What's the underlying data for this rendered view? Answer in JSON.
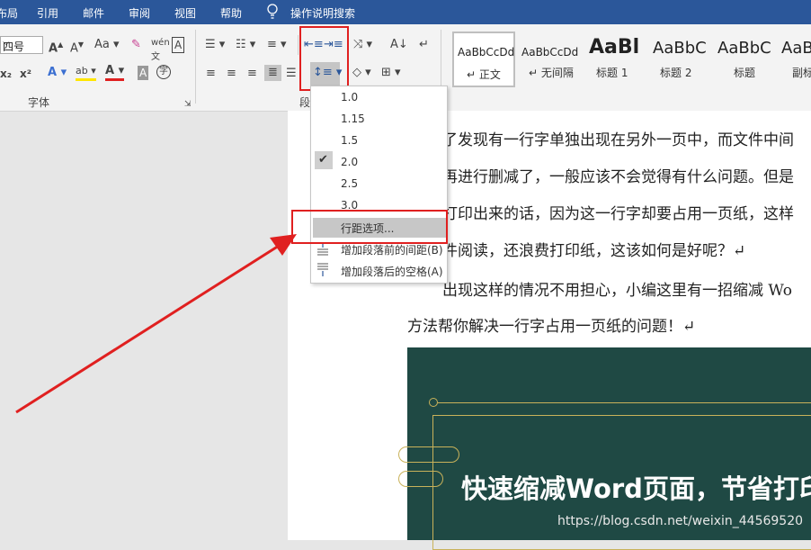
{
  "menubar": {
    "items": [
      "布局",
      "引用",
      "邮件",
      "审阅",
      "视图",
      "帮助"
    ],
    "search": "操作说明搜索"
  },
  "ribbon": {
    "font_size_value": "四号",
    "font_group_label": "字体",
    "para_group_label": "段"
  },
  "styles": [
    {
      "preview": "AaBbCcDd",
      "name": "↵ 正文"
    },
    {
      "preview": "AaBbCcDd",
      "name": "↵ 无间隔"
    },
    {
      "preview": "AaBl",
      "name": "标题 1"
    },
    {
      "preview": "AaBbC",
      "name": "标题 2"
    },
    {
      "preview": "AaBbC",
      "name": "标题"
    },
    {
      "preview": "AaBb",
      "name": "副标"
    }
  ],
  "line_spacing_menu": {
    "options": [
      "1.0",
      "1.15",
      "1.5",
      "2.0",
      "2.5",
      "3.0"
    ],
    "checked": "2.0",
    "line_spacing_options": "行距选项...",
    "add_space_before": "增加段落前的间距(B)",
    "add_space_after": "增加段落后的空格(A)"
  },
  "document": {
    "lines": [
      "了发现有一行字单独出现在另外一页中，而文件中间",
      "再进行删减了，一般应该不会觉得有什么问题。但是",
      "打印出来的话，因为这一行字却要占用一页纸，这样",
      "件阅读，还浪费打印纸，这该如何是好呢？↵",
      "出现这样的情况不用担心，小编这里有一招缩减 Wo",
      "方法帮你解决一行字占用一页纸的问题！↵"
    ],
    "banner_title": "快速缩减Word页面，节省打印",
    "watermark": "https://blog.csdn.net/weixin_44569520"
  },
  "colors": {
    "menubar": "#2b579a",
    "highlight_red": "#e02020",
    "banner": "#1f4944"
  }
}
